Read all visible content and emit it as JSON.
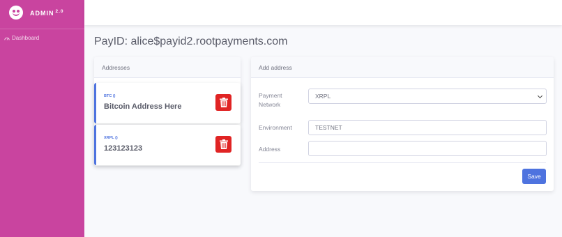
{
  "sidebar": {
    "brand": {
      "name": "ADMIN",
      "version": "2.0"
    },
    "items": [
      {
        "label": "Dashboard",
        "icon": "dashboard-icon"
      }
    ]
  },
  "page": {
    "title": "PayID: alice$payid2.rootpayments.com"
  },
  "addresses": {
    "header": "Addresses",
    "items": [
      {
        "network": "BTC ()",
        "value": "Bitcoin Address Here"
      },
      {
        "network": "XRPL ()",
        "value": "123123123"
      }
    ]
  },
  "add_address": {
    "header": "Add address",
    "payment_network": {
      "label": "Payment Network",
      "value": "XRPL"
    },
    "environment": {
      "label": "Environment",
      "value": "TESTNET"
    },
    "address": {
      "label": "Address",
      "value": ""
    },
    "save_label": "Save"
  },
  "colors": {
    "sidebar": "#c9449f",
    "accent": "#4e73df",
    "danger": "#e02424"
  }
}
